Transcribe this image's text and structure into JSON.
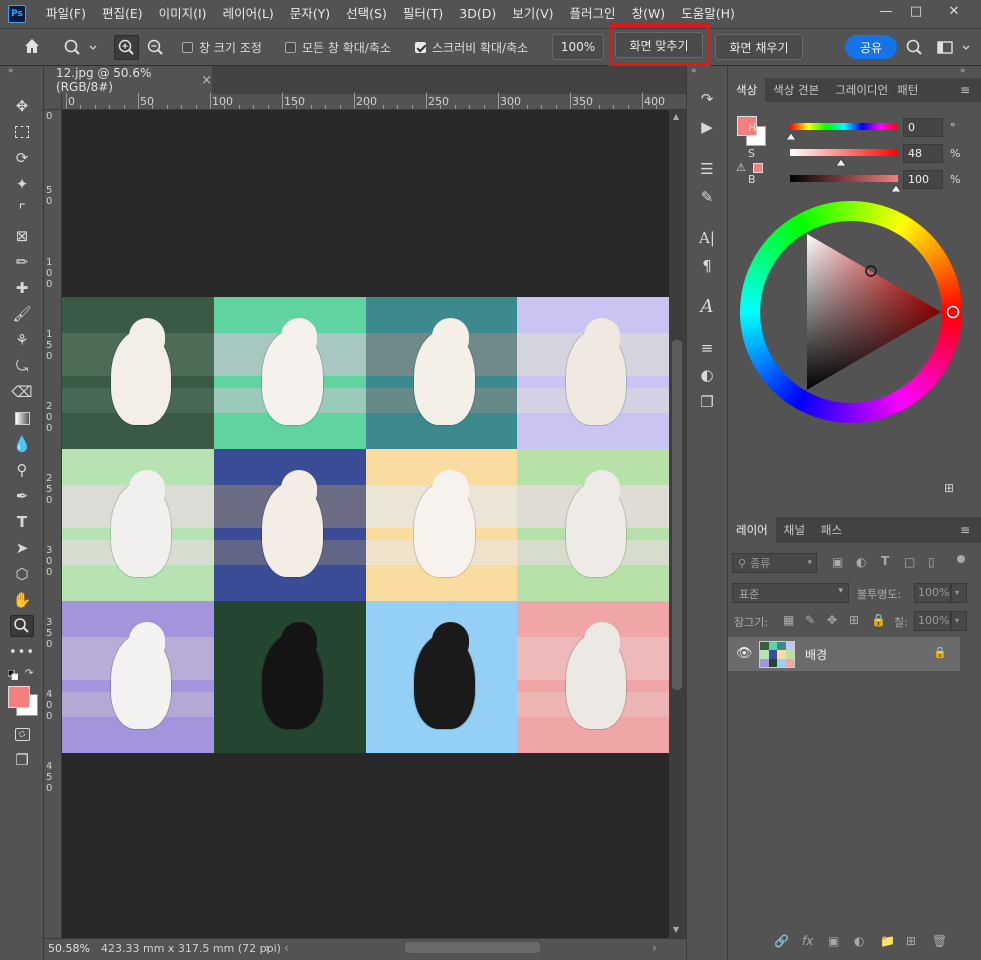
{
  "app": {
    "logo": "Ps"
  },
  "menu": [
    "파일(F)",
    "편집(E)",
    "이미지(I)",
    "레이어(L)",
    "문자(Y)",
    "선택(S)",
    "필터(T)",
    "3D(D)",
    "보기(V)",
    "플러그인",
    "창(W)",
    "도움말(H)"
  ],
  "options": {
    "resize_windows": "창 크기 조정",
    "zoom_all_windows": "모든 창 확대/축소",
    "scrubby_zoom": "스크러비 확대/축소",
    "zoom_value": "100%",
    "fit_screen": "화면 맞추기",
    "fill_screen": "화면 채우기",
    "share": "공유"
  },
  "document": {
    "tab_title": "12.jpg @ 50.6% (RGB/8#)"
  },
  "ruler_top": [
    "0",
    "50",
    "100",
    "150",
    "200",
    "250",
    "300",
    "350",
    "400"
  ],
  "ruler_left": [
    [
      "0"
    ],
    [
      "5",
      "0"
    ],
    [
      "1",
      "0",
      "0"
    ],
    [
      "1",
      "5",
      "0"
    ],
    [
      "2",
      "0",
      "0"
    ],
    [
      "2",
      "5",
      "0"
    ],
    [
      "3",
      "0",
      "0"
    ],
    [
      "3",
      "5",
      "0"
    ],
    [
      "4",
      "0",
      "0"
    ],
    [
      "4",
      "5",
      "0"
    ]
  ],
  "status": {
    "zoom": "50.58%",
    "doc_size": "423.33 mm x 317.5 mm (72 ppi)"
  },
  "color_panel": {
    "tabs": [
      "색상",
      "색상 견본",
      "그레이디언트",
      "패턴"
    ],
    "h_label": "H",
    "h_value": "0",
    "h_unit": "°",
    "s_label": "S",
    "s_value": "48",
    "s_unit": "%",
    "b_label": "B",
    "b_value": "100",
    "b_unit": "%",
    "foreground": "#f57f7f"
  },
  "layers_panel": {
    "tabs": [
      "레이어",
      "채널",
      "패스"
    ],
    "filter_kind": "종류",
    "blend_mode": "표준",
    "opacity_label": "불투명도:",
    "opacity_value": "100%",
    "lock_label": "잠그기:",
    "fill_label": "칠:",
    "fill_value": "100%",
    "layer_name": "배경"
  },
  "tiles": [
    {
      "bg": "#3b5a45",
      "band": "#4e6b56",
      "pet": "#f3eee6"
    },
    {
      "bg": "#5fd3a0",
      "band": "#a7c8c0",
      "pet": "#f5f2ee"
    },
    {
      "bg": "#3c8a8e",
      "band": "#6f8a88",
      "pet": "#f4efe7"
    },
    {
      "bg": "#c9c4f2",
      "band": "#d6d4de",
      "pet": "#efe9e2"
    },
    {
      "bg": "#b7e3b2",
      "band": "#dcdcd6",
      "pet": "#f2f0ee"
    },
    {
      "bg": "#3b4c96",
      "band": "#6c6c84",
      "pet": "#f3ede5"
    },
    {
      "bg": "#fbdca0",
      "band": "#ece4d4",
      "pet": "#f6f3ef"
    },
    {
      "bg": "#b6e2a9",
      "band": "#dedcd4",
      "pet": "#eeeae6"
    },
    {
      "bg": "#a394db",
      "band": "#b9acd8",
      "pet": "#f4f2f0"
    },
    {
      "bg": "#24452f",
      "band": "#24452f",
      "pet": "#141414"
    },
    {
      "bg": "#94cff5",
      "band": "#94cff5",
      "pet": "#1a1a1a"
    },
    {
      "bg": "#f0a6a6",
      "band": "#eeb9b9",
      "pet": "#ece8e4"
    }
  ]
}
